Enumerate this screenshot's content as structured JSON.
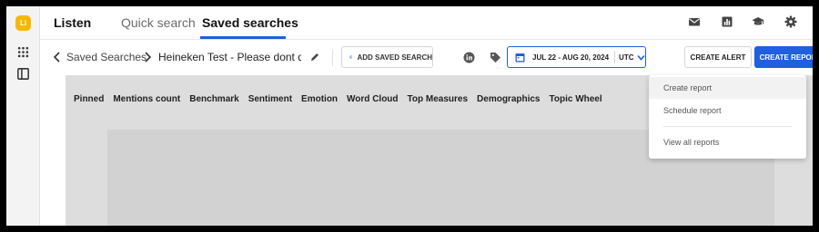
{
  "rail": {
    "logo_text": "Li",
    "icons": [
      "app-grid-icon",
      "panel-toggle-icon"
    ]
  },
  "header": {
    "app_title": "Listen",
    "tabs": [
      {
        "label": "Quick search",
        "active": false
      },
      {
        "label": "Saved searches",
        "active": true
      }
    ],
    "icons": [
      "mail-icon",
      "chart-icon",
      "graduation-cap-icon",
      "gear-icon"
    ]
  },
  "toolbar": {
    "breadcrumb_root": "Saved Searches",
    "breadcrumb_current": "Heineken Test - Please dont de...",
    "add_saved_search_label": "ADD SAVED SEARCH",
    "date_range": "JUL 22 - AUG 20, 2024",
    "timezone": "UTC",
    "create_alert_label": "CREATE ALERT",
    "create_report_label": "CREATE REPORT"
  },
  "section_tabs": [
    "Pinned",
    "Mentions count",
    "Benchmark",
    "Sentiment",
    "Emotion",
    "Word Cloud",
    "Top Measures",
    "Demographics",
    "Topic Wheel"
  ],
  "dropdown": {
    "items": [
      "Create report",
      "Schedule report",
      "View all reports"
    ]
  },
  "colors": {
    "accent": "#1f5fe0",
    "logo": "#f5b800",
    "content_bg": "#dddddd"
  }
}
